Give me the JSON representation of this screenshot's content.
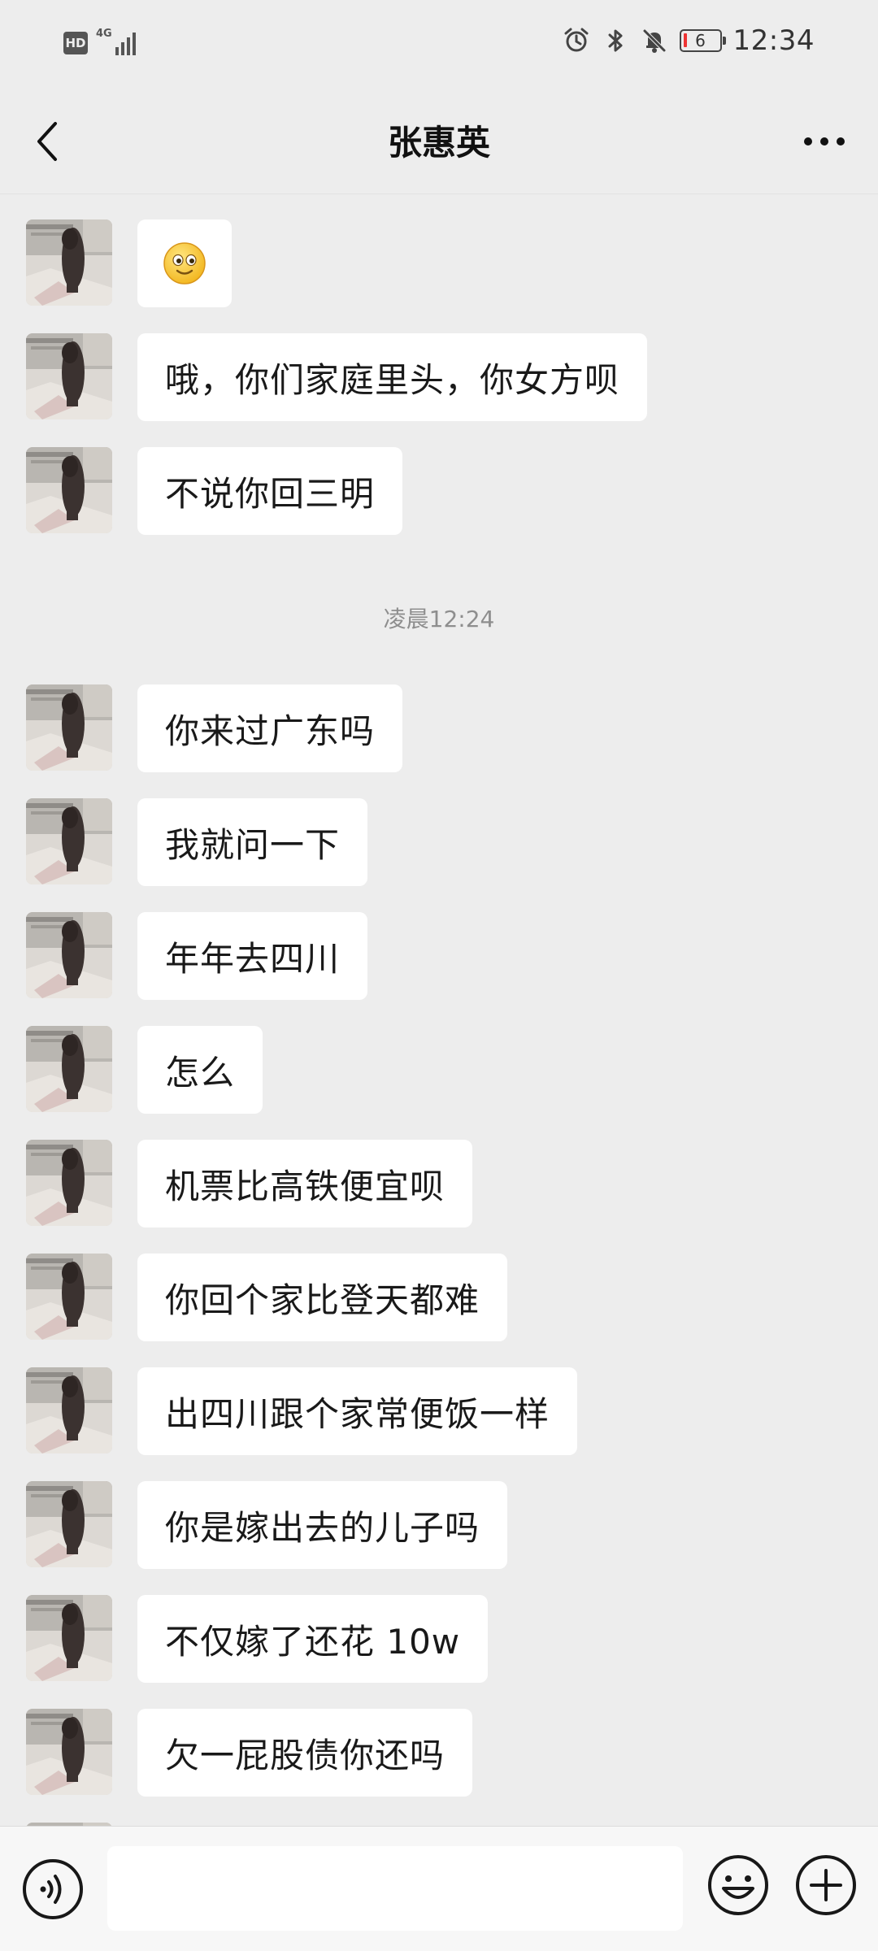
{
  "status_bar": {
    "hd_label": "HD",
    "network_label": "4G",
    "battery_level": "6",
    "time": "12:34",
    "icons": [
      "signal-icon",
      "alarm-icon",
      "bluetooth-icon",
      "mute-icon",
      "battery-icon"
    ]
  },
  "header": {
    "title": "张惠英",
    "back_icon": "chevron-left-icon",
    "more_icon": "more-dots-icon"
  },
  "chat": {
    "messages": [
      {
        "type": "emoji",
        "emoji": "smile"
      },
      {
        "type": "text",
        "text": "哦，你们家庭里头，你女方呗"
      },
      {
        "type": "text",
        "text": "不说你回三明"
      }
    ],
    "timestamp": "凌晨12:24",
    "messages_after": [
      {
        "type": "text",
        "text": "你来过广东吗"
      },
      {
        "type": "text",
        "text": "我就问一下"
      },
      {
        "type": "text",
        "text": "年年去四川"
      },
      {
        "type": "text",
        "text": "怎么"
      },
      {
        "type": "text",
        "text": "机票比高铁便宜呗"
      },
      {
        "type": "text",
        "text": "你回个家比登天都难"
      },
      {
        "type": "text",
        "text": "出四川跟个家常便饭一样"
      },
      {
        "type": "text",
        "text": "你是嫁出去的儿子吗"
      },
      {
        "type": "text",
        "text": "不仅嫁了还花 10w"
      },
      {
        "type": "text",
        "text": "欠一屁股债你还吗"
      }
    ]
  },
  "input_bar": {
    "voice_icon": "voice-icon",
    "input_value": "",
    "emoji_icon": "emoji-icon",
    "plus_icon": "plus-icon"
  },
  "colors": {
    "background": "#ededed",
    "bubble": "#ffffff",
    "text": "#191919",
    "timestamp": "#8e8e8e"
  }
}
